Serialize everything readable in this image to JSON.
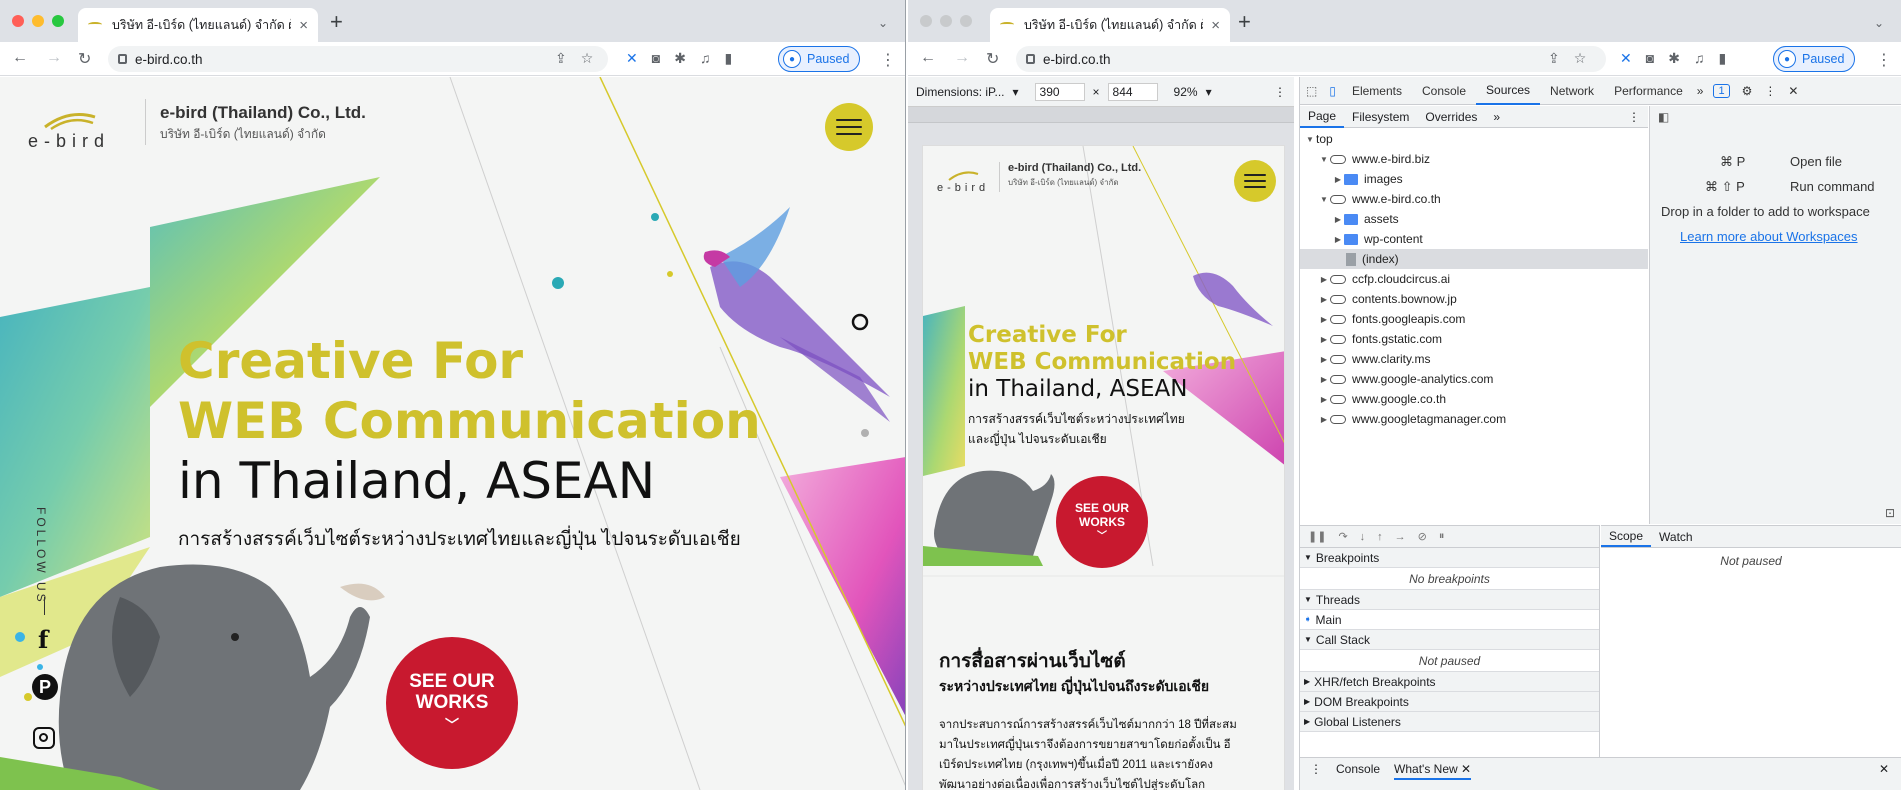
{
  "left": {
    "tab_title": "บริษัท อี-เบิร์ด (ไทยแลนด์) จำกัด ผู้",
    "url": "e-bird.co.th",
    "profile": "Paused",
    "site": {
      "logo_word": "e-bird",
      "company_en": "e-bird (Thailand) Co., Ltd.",
      "company_th": "บริษัท อี-เบิร์ด (ไทยแลนด์) จำกัด",
      "headline_1": "Creative For",
      "headline_2": "WEB Communication",
      "headline_3": "in Thailand, ASEAN",
      "subline": "การสร้างสรรค์เว็บไซต์ระหว่างประเทศไทยและญี่ปุ่น ไปจนระดับเอเชีย",
      "cta_line1": "SEE OUR",
      "cta_line2": "WORKS",
      "follow": "FOLLOW US",
      "social_facebook": "f",
      "social_pinterest": "P"
    }
  },
  "right": {
    "tab_title": "บริษัท อี-เบิร์ด (ไทยแลนด์) จำกัด ผู้",
    "url": "e-bird.co.th",
    "profile": "Paused",
    "device_bar": {
      "dimensions_label": "Dimensions: iP...",
      "width": "390",
      "height": "844",
      "zoom": "92%"
    },
    "mobile": {
      "company_en": "e-bird (Thailand) Co., Ltd.",
      "company_th": "บริษัท อี-เบิร์ด (ไทยแลนด์) จำกัด",
      "headline_1": "Creative For",
      "headline_2": "WEB Communication",
      "headline_3": "in Thailand, ASEAN",
      "subline_1": "การสร้างสรรค์เว็บไซต์ระหว่างประเทศไทย",
      "subline_2": "และญี่ปุ่น ไปจนระดับเอเชีย",
      "cta_line1": "SEE OUR",
      "cta_line2": "WORKS",
      "section_title": "การสื่อสารผ่านเว็บไซต์",
      "section_sub": "ระหว่างประเทศไทย ญี่ปุ่นไปจนถึงระดับเอเชีย",
      "para_1": "จากประสบการณ์การสร้างสรรค์เว็บไซต์มากกว่า 18 ปีที่สะสม",
      "para_2": "มาในประเทศญี่ปุ่นเราจึงต้องการขยายสาขาโดยก่อตั้งเป็น อี",
      "para_3": "เบิร์ดประเทศไทย (กรุงเทพฯ)ขึ้นเมื่อปี 2011 และเรายังคง",
      "para_4": "พัฒนาอย่างต่อเนื่องเพื่อการสร้างเว็บไซต์ไปสู่ระดับโลก"
    },
    "devtools": {
      "tabs": [
        "Elements",
        "Console",
        "Sources",
        "Network",
        "Performance"
      ],
      "issues_count": "1",
      "nav_tabs": [
        "Page",
        "Filesystem",
        "Overrides"
      ],
      "tree": [
        {
          "label": "top",
          "indent": 0,
          "kind": "none",
          "arrow": "down"
        },
        {
          "label": "www.e-bird.biz",
          "indent": 1,
          "kind": "cloud",
          "arrow": "down"
        },
        {
          "label": "images",
          "indent": 2,
          "kind": "folder",
          "arrow": "right"
        },
        {
          "label": "www.e-bird.co.th",
          "indent": 1,
          "kind": "cloud",
          "arrow": "down"
        },
        {
          "label": "assets",
          "indent": 2,
          "kind": "folder",
          "arrow": "right"
        },
        {
          "label": "wp-content",
          "indent": 2,
          "kind": "folder",
          "arrow": "right"
        },
        {
          "label": "(index)",
          "indent": 2,
          "kind": "file",
          "arrow": "none"
        },
        {
          "label": "ccfp.cloudcircus.ai",
          "indent": 1,
          "kind": "cloud",
          "arrow": "right"
        },
        {
          "label": "contents.bownow.jp",
          "indent": 1,
          "kind": "cloud",
          "arrow": "right"
        },
        {
          "label": "fonts.googleapis.com",
          "indent": 1,
          "kind": "cloud",
          "arrow": "right"
        },
        {
          "label": "fonts.gstatic.com",
          "indent": 1,
          "kind": "cloud",
          "arrow": "right"
        },
        {
          "label": "www.clarity.ms",
          "indent": 1,
          "kind": "cloud",
          "arrow": "right"
        },
        {
          "label": "www.google-analytics.com",
          "indent": 1,
          "kind": "cloud",
          "arrow": "right"
        },
        {
          "label": "www.google.co.th",
          "indent": 1,
          "kind": "cloud",
          "arrow": "right"
        },
        {
          "label": "www.googletagmanager.com",
          "indent": 1,
          "kind": "cloud",
          "arrow": "right"
        }
      ],
      "shortcut_1_keys": "⌘ P",
      "shortcut_1_label": "Open file",
      "shortcut_2_keys": "⌘ ⇧ P",
      "shortcut_2_label": "Run command",
      "drop_text": "Drop in a folder to add to workspace",
      "learn_more": "Learn more about Workspaces",
      "breakpoints_title": "Breakpoints",
      "breakpoints_empty": "No breakpoints",
      "threads_title": "Threads",
      "thread_main": "Main",
      "callstack_title": "Call Stack",
      "callstack_empty": "Not paused",
      "xhr": "XHR/fetch Breakpoints",
      "dom": "DOM Breakpoints",
      "global": "Global Listeners",
      "scope_tab": "Scope",
      "watch_tab": "Watch",
      "scope_empty": "Not paused",
      "drawer_console": "Console",
      "drawer_whatsnew": "What's New"
    }
  },
  "colors": {
    "brand_yellow": "#cfc12d",
    "cta_red": "#c8192f",
    "link_blue": "#1a73e8"
  }
}
